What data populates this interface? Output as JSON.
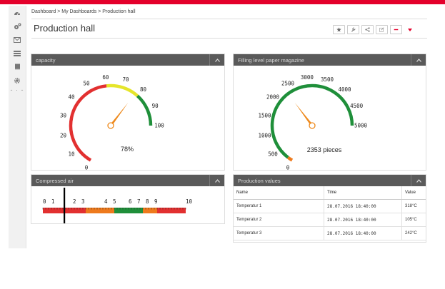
{
  "breadcrumb": {
    "items": [
      "Dashboard",
      "My Dashboards",
      "Production hall"
    ],
    "separator": " > "
  },
  "page": {
    "title": "Production hall"
  },
  "toolbar": {
    "buttons": [
      "star-icon",
      "wrench-icon",
      "share-icon",
      "edit-icon",
      "minus-icon"
    ],
    "menu_icon": "caret-down-icon"
  },
  "sidebar": {
    "icons": [
      "dashboard-icon",
      "gears-icon",
      "envelope-icon",
      "server-icon",
      "book-icon",
      "settings-icon"
    ]
  },
  "colors": {
    "accent": "#e4002b",
    "panel_header": "#5a5a5a",
    "gauge_green": "#1f8f3a",
    "gauge_yellow": "#e5e52a",
    "gauge_red": "#e23030",
    "gauge_orange": "#ee7a1d",
    "needle": "#ee8a1d"
  },
  "panels": {
    "capacity": {
      "title": "capacity",
      "min": 0,
      "max": 100,
      "ticks": [
        "0",
        "10",
        "20",
        "30",
        "40",
        "50",
        "60",
        "70",
        "80",
        "90",
        "100"
      ],
      "value": 78,
      "value_label": "78%",
      "bands": [
        {
          "from": 0,
          "to": 60,
          "color": "#e23030"
        },
        {
          "from": 60,
          "to": 80,
          "color": "#e5e52a"
        },
        {
          "from": 80,
          "to": 100,
          "color": "#1f8f3a"
        }
      ]
    },
    "filling": {
      "title": "Filling level paper magazine",
      "min": 0,
      "max": 5000,
      "ticks": [
        "0",
        "500",
        "1000",
        "1500",
        "2000",
        "2500",
        "3000",
        "3500",
        "4000",
        "4500",
        "5000"
      ],
      "value": 2353,
      "value_label": "2353 pieces",
      "bands": [
        {
          "from": 0,
          "to": 150,
          "color": "#ee7a1d"
        },
        {
          "from": 150,
          "to": 5000,
          "color": "#1f8f3a"
        }
      ]
    },
    "air": {
      "title": "Compressed air",
      "labels": [
        {
          "text": "0",
          "v": 0
        },
        {
          "text": "1",
          "v": 1
        },
        {
          "text": "2",
          "v": 2
        },
        {
          "text": "3",
          "v": 3
        },
        {
          "text": "4",
          "v": 4
        },
        {
          "text": "5",
          "v": 5
        },
        {
          "text": "6",
          "v": 6
        },
        {
          "text": "7",
          "v": 7
        },
        {
          "text": "8",
          "v": 8
        },
        {
          "text": "9",
          "v": 9
        },
        {
          "text": "10",
          "v": 10
        }
      ],
      "min": 0,
      "max": 10,
      "value": 1.5,
      "bands": [
        {
          "from": 0,
          "to": 3,
          "color": "#e23030"
        },
        {
          "from": 3,
          "to": 5,
          "color": "#ee7a1d"
        },
        {
          "from": 5,
          "to": 7,
          "color": "#1f8f3a"
        },
        {
          "from": 7,
          "to": 8,
          "color": "#ee7a1d"
        },
        {
          "from": 8,
          "to": 10,
          "color": "#e23030"
        }
      ]
    },
    "production": {
      "title": "Production values",
      "columns": [
        "Name",
        "Time",
        "Value"
      ],
      "rows": [
        [
          "Temperatur 1",
          "28.07.2016 18:40:00",
          "318°C"
        ],
        [
          "Temperatur 2",
          "28.07.2016 18:40:00",
          "105°C"
        ],
        [
          "Temperatur 3",
          "28.07.2016 18:40:00",
          "242°C"
        ]
      ]
    }
  }
}
